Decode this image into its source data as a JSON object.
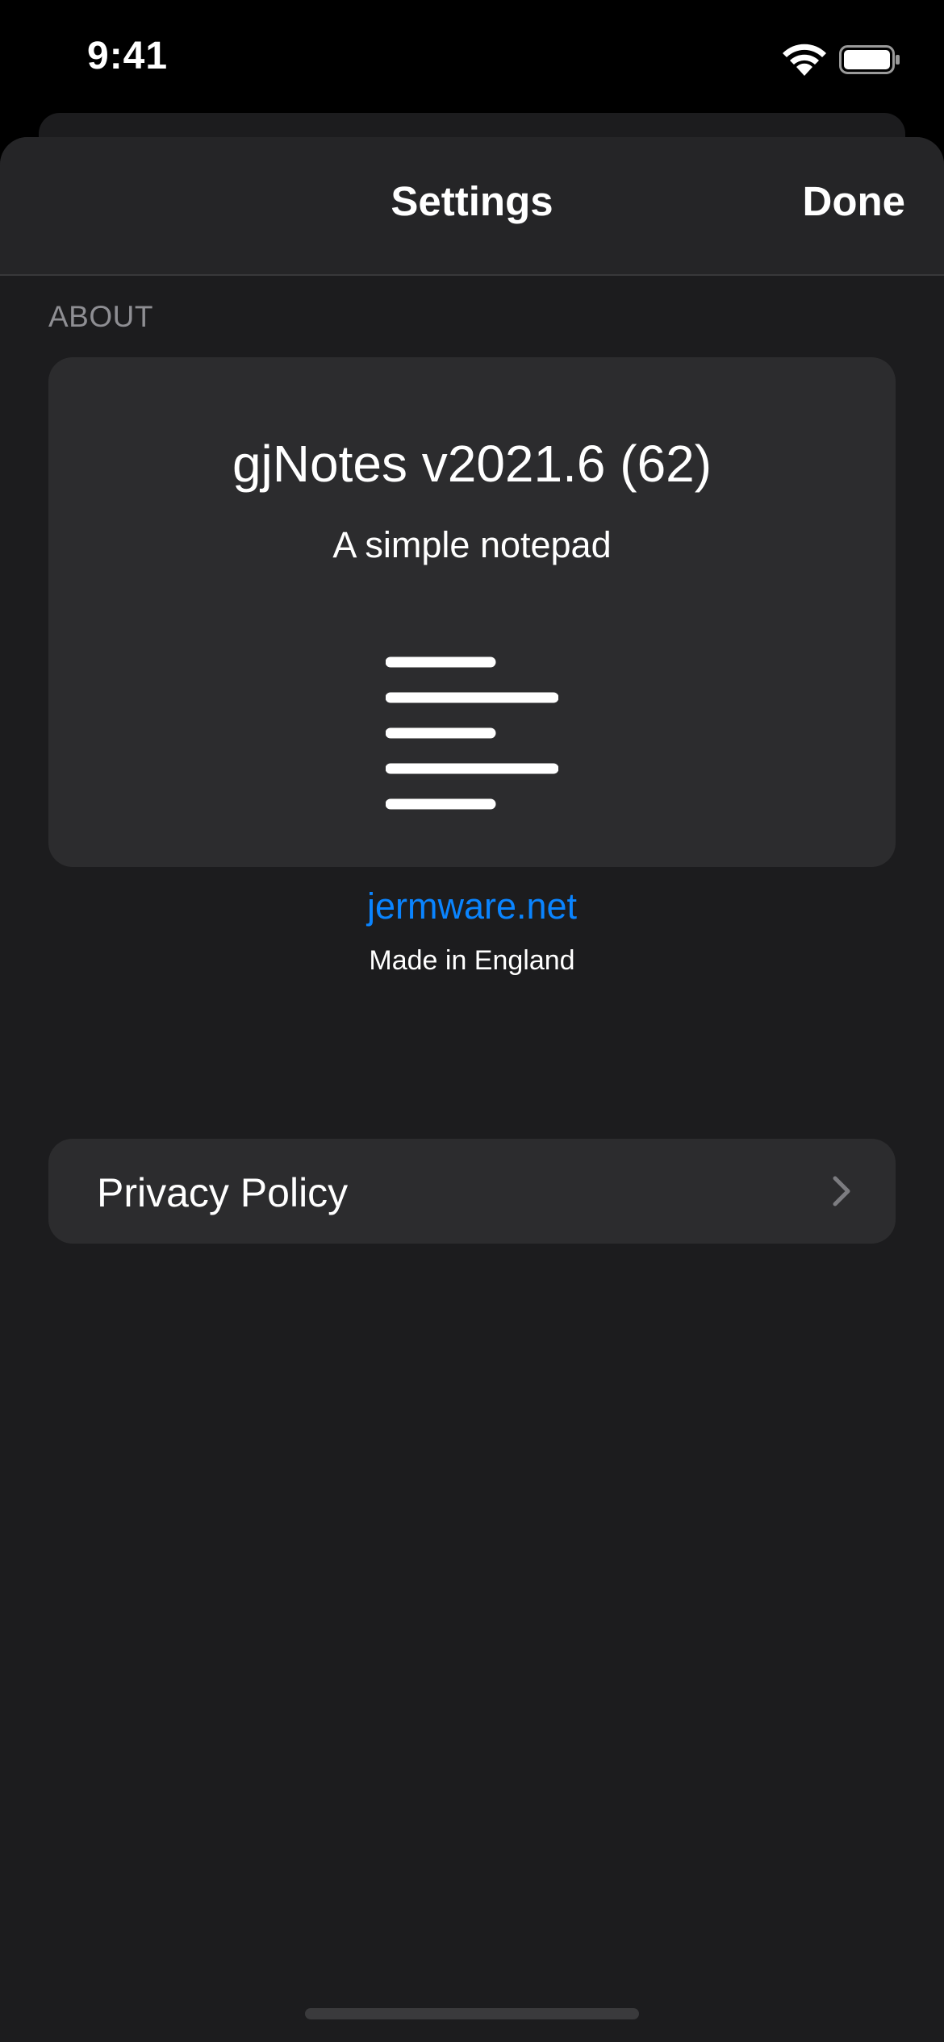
{
  "status_bar": {
    "time": "9:41",
    "wifi_icon": "wifi-icon",
    "battery_icon": "battery-icon"
  },
  "nav": {
    "title": "Settings",
    "done_label": "Done"
  },
  "about_section": {
    "header": "ABOUT",
    "app_title": "gjNotes v2021.6 (62)",
    "app_subtitle": "A simple notepad",
    "logo_icon": "notes-lines-icon",
    "website_link": "jermware.net",
    "made_in": "Made in England"
  },
  "privacy_row": {
    "label": "Privacy Policy",
    "chevron_icon": "chevron-right-icon"
  },
  "colors": {
    "background": "#1c1c1e",
    "card": "#2c2c2e",
    "link": "#0a84ff",
    "secondary_text": "#8e8e93"
  }
}
